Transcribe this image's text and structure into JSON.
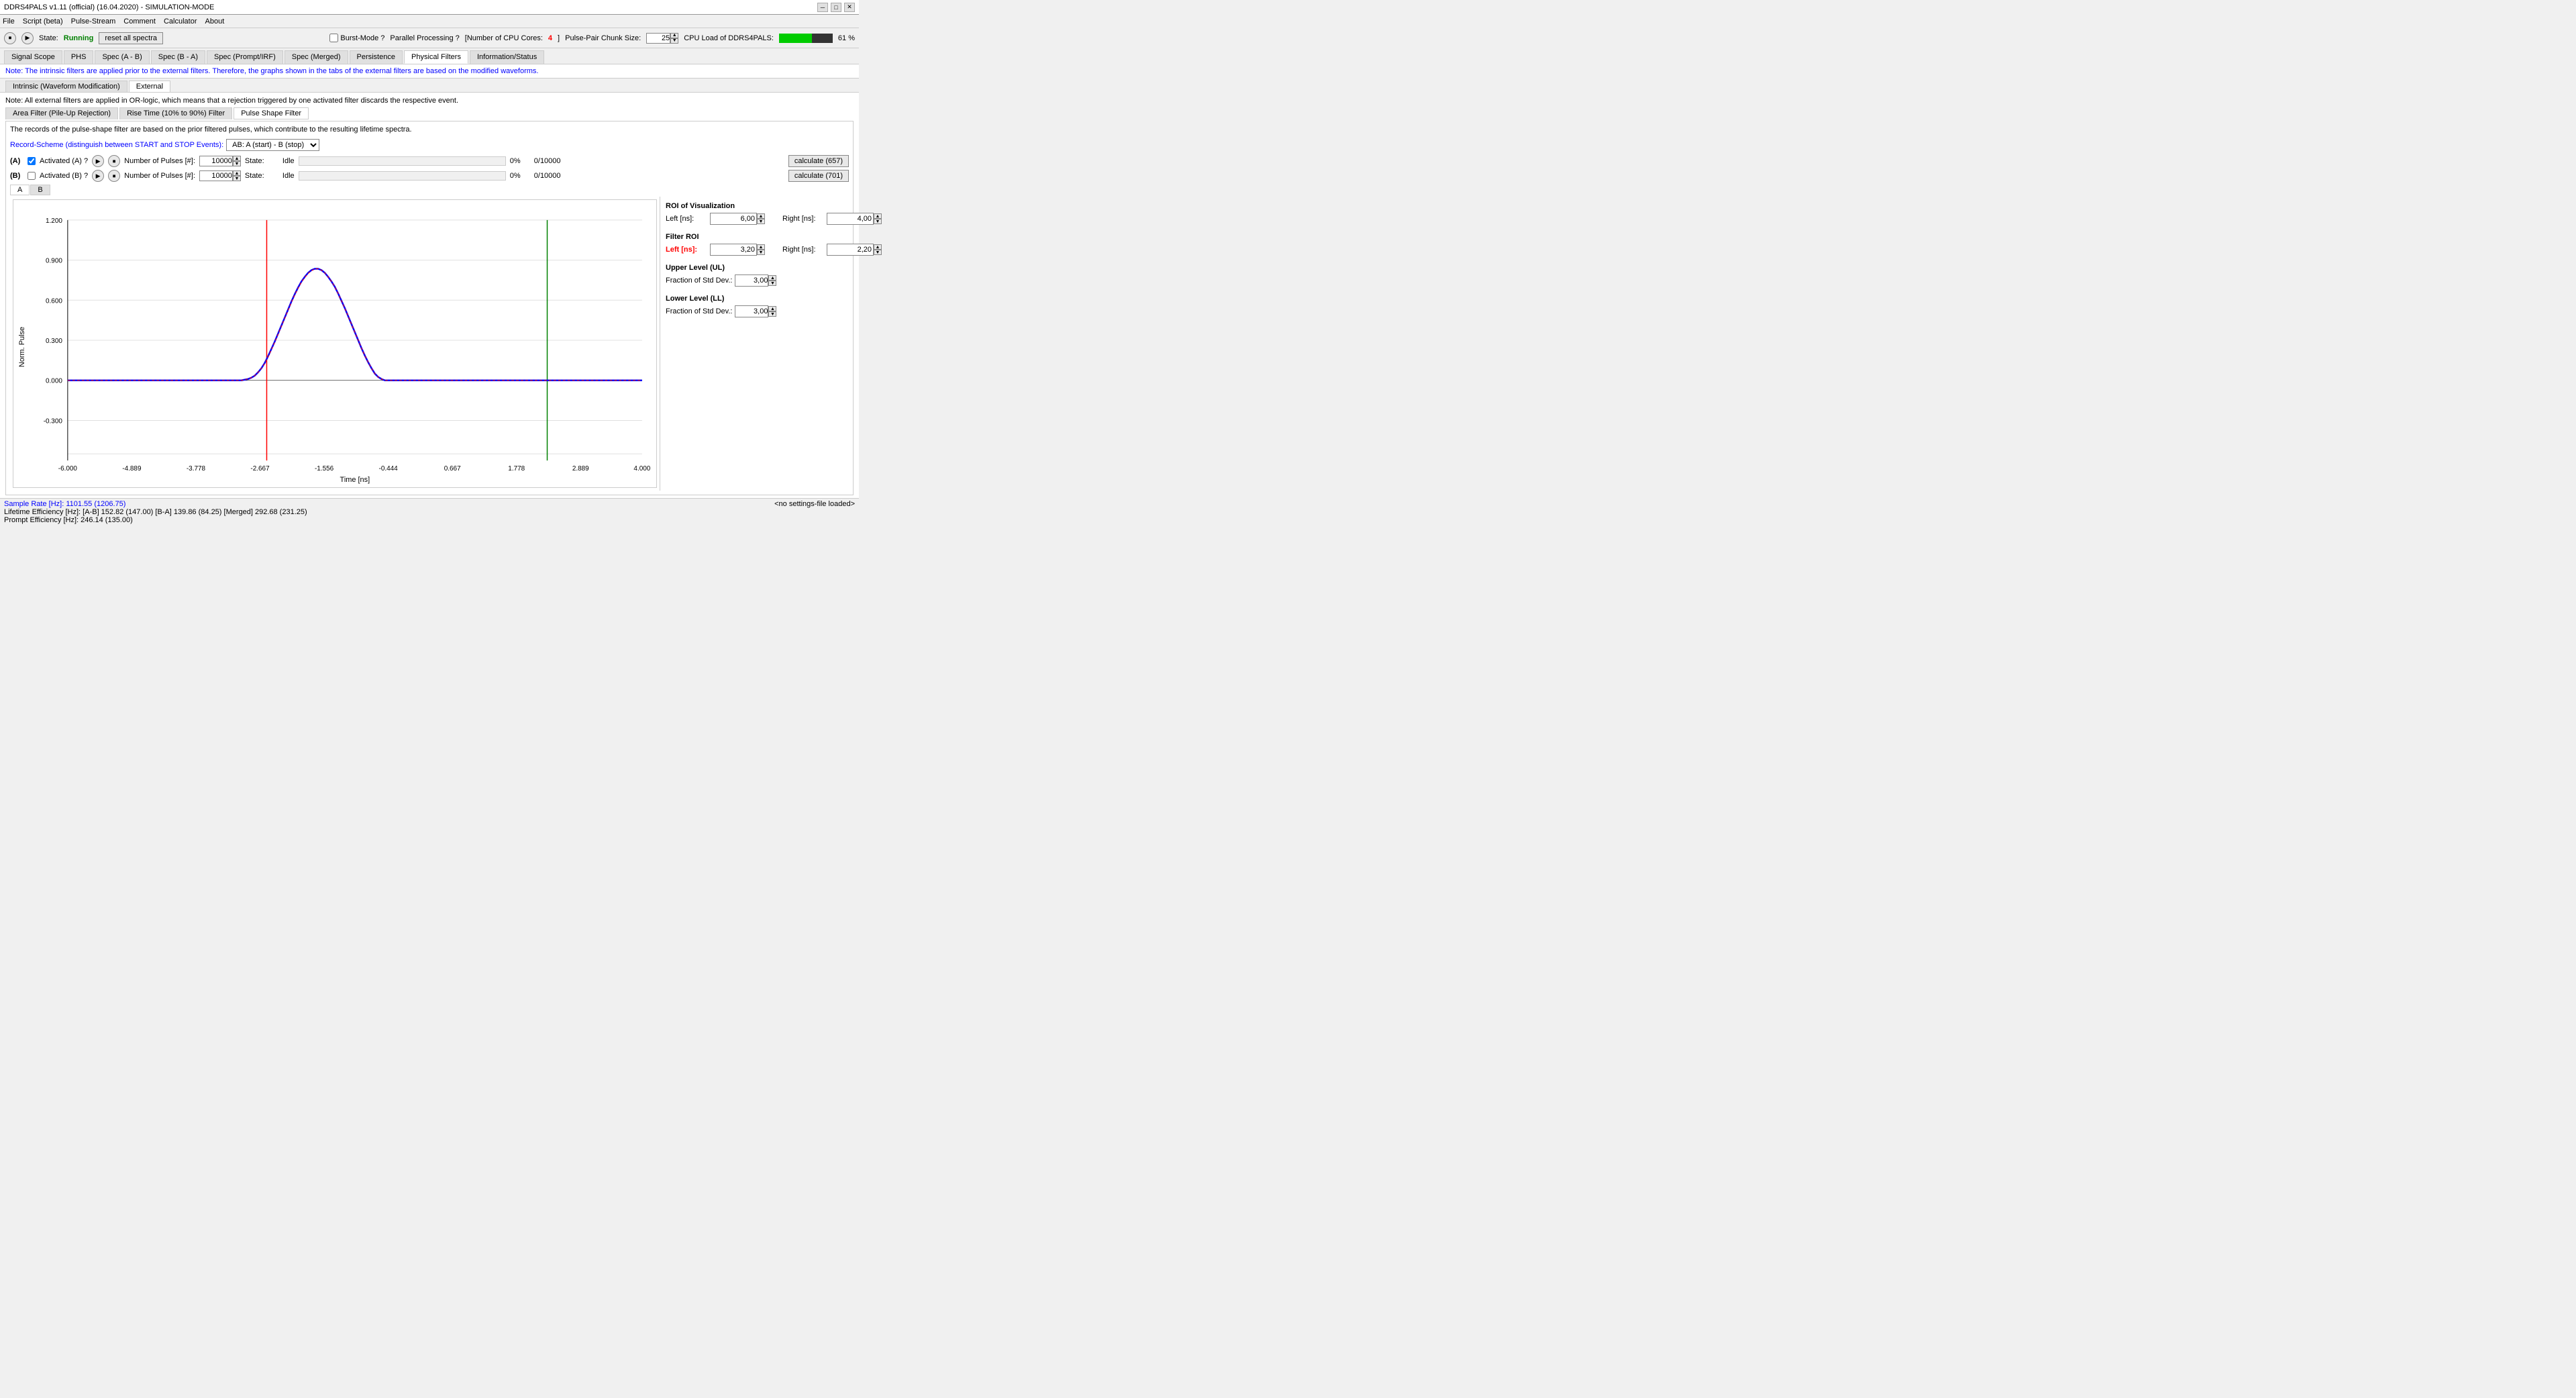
{
  "titleBar": {
    "title": "DDRS4PALS v1.11 (official) (16.04.2020) - SIMULATION-MODE",
    "minimizeLabel": "─",
    "maximizeLabel": "□",
    "closeLabel": "✕"
  },
  "menuBar": {
    "items": [
      "File",
      "Script (beta)",
      "Pulse-Stream",
      "Comment",
      "Calculator",
      "About"
    ]
  },
  "toolbar": {
    "stateLabel": "State:",
    "stateValue": "Running",
    "resetLabel": "reset all spectra",
    "burstModeLabel": "Burst-Mode ?",
    "parallelLabel": "Parallel Processing ?",
    "cpuCoresLabel": "[Number of CPU Cores:",
    "cpuCoresValue": "4",
    "cpuCoresBracket": "]",
    "chunkLabel": "Pulse-Pair Chunk Size:",
    "chunkValue": "25",
    "cpuLoadLabel": "CPU Load of DDRS4PALS:",
    "cpuLoadPercent": "61 %",
    "cpuLoadValue": 61
  },
  "mainTabs": {
    "items": [
      "Signal Scope",
      "PHS",
      "Spec (A - B)",
      "Spec (B - A)",
      "Spec (Prompt/IRF)",
      "Spec (Merged)",
      "Persistence",
      "Physical Filters",
      "Information/Status"
    ],
    "activeIndex": 7
  },
  "noteBlue": "Note: The intrinsic filters are applied prior to the external filters. Therefore, the graphs shown in the tabs of the external filters are based on the modified waveforms.",
  "subTabs": {
    "items": [
      "Intrinsic (Waveform Modification)",
      "External"
    ],
    "activeIndex": 1
  },
  "note2": "Note: All external filters are applied in OR-logic, which means that a rejection triggered by one activated filter discards the respective event.",
  "filterTabs": {
    "items": [
      "Area Filter (Pile-Up Rejection)",
      "Rise Time (10% to 90%) Filter",
      "Pulse Shape Filter"
    ],
    "activeIndex": 2
  },
  "filterNote": "The records of the pulse-shape filter are based on the prior filtered pulses, which contribute to the resulting lifetime spectra.",
  "recordScheme": {
    "label": "Record-Scheme (distinguish between START and STOP Events):",
    "value": "AB: A (start) - B (stop)",
    "options": [
      "AB: A (start) - B (stop)"
    ]
  },
  "channelA": {
    "prefix": "(A)",
    "activatedLabel": "Activated (A) ?",
    "checked": true,
    "pulsesLabel": "Number of Pulses [#]:",
    "pulsesValue": "10000",
    "stateLabel": "State:",
    "stateValue": "Idle",
    "percent": "0%",
    "count": "0/10000",
    "calcLabel": "calculate (657)"
  },
  "channelB": {
    "prefix": "(B)",
    "activatedLabel": "Activated (B) ?",
    "checked": false,
    "pulsesLabel": "Number of Pulses [#]:",
    "pulsesValue": "10000",
    "stateLabel": "State:",
    "stateValue": "Idle",
    "percent": "0%",
    "count": "0/10000",
    "calcLabel": "calculate (701)"
  },
  "abTabs": {
    "items": [
      "A",
      "B"
    ],
    "activeIndex": 0
  },
  "chart": {
    "yAxisLabel": "Norm. Pulse",
    "xAxisLabel": "Time [ns]",
    "yTicks": [
      "1.200",
      "0.900",
      "0.600",
      "0.300",
      "0.000",
      "-0.300"
    ],
    "xTicks": [
      "-6.000",
      "-4.889",
      "-3.778",
      "-2.667",
      "-1.556",
      "-0.444",
      "0.667",
      "1.778",
      "2.889",
      "4.000"
    ],
    "redLineX": -2.3,
    "greenLineX": 2.05
  },
  "roiViz": {
    "title": "ROI of Visualization",
    "leftLabel": "Left [ns]:",
    "leftValue": "6,00",
    "rightLabel": "Right [ns]:",
    "rightValue": "4,00"
  },
  "filterROI": {
    "title": "Filter ROI",
    "leftLabel": "Left [ns]:",
    "leftValue": "3,20",
    "rightLabel": "Right [ns]:",
    "rightValue": "2,20"
  },
  "upperLevel": {
    "title": "Upper Level (UL)",
    "fractionLabel": "Fraction of Std Dev.:",
    "fractionValue": "3,00"
  },
  "lowerLevel": {
    "title": "Lower Level (LL)",
    "fractionLabel": "Fraction of Std Dev.:",
    "fractionValue": "3,00"
  },
  "statusBar": {
    "sampleRate": "Sample Rate [Hz]: 1101.55 (1206.75)",
    "lifetimeEff": "Lifetime Efficiency  [Hz]:    [A-B] 152.82 (147.00) [B-A] 139.86 (84.25) [Merged] 292.68 (231.25)",
    "promptEff": "Prompt Efficiency   [Hz]:    246.14 (135.00)",
    "noSettings": "<no settings-file loaded>"
  }
}
